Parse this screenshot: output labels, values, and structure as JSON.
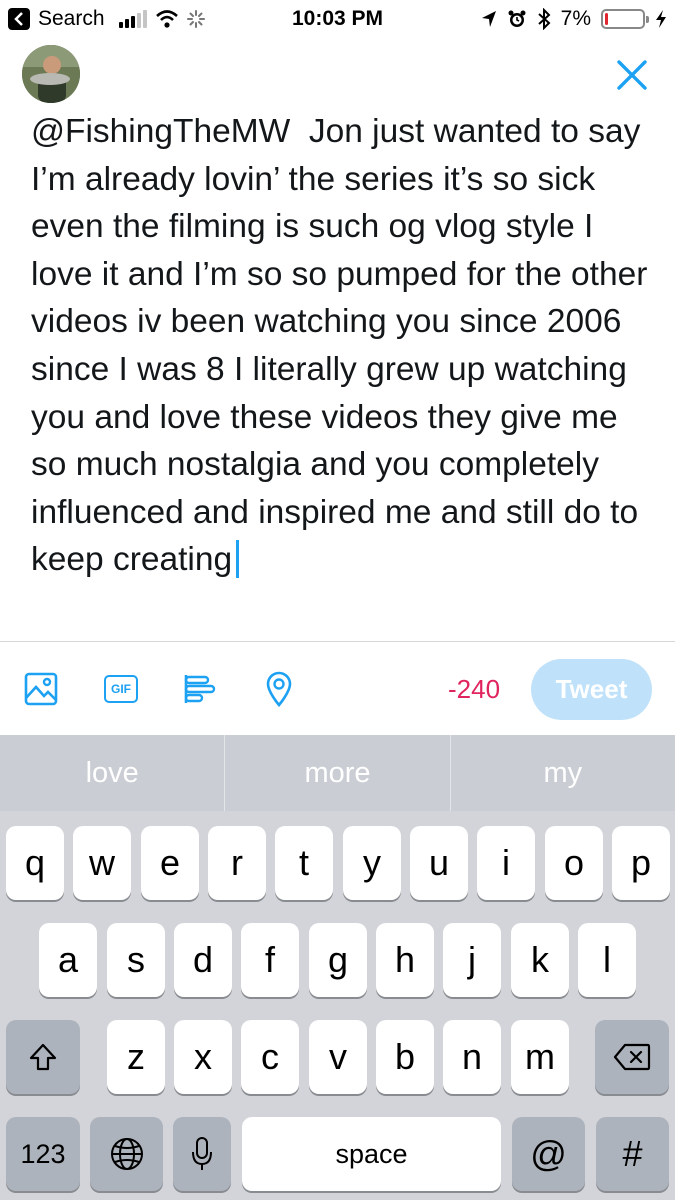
{
  "status_bar": {
    "back_label": "Search",
    "time": "10:03 PM",
    "battery_percent": "7%",
    "battery_level": 0.07,
    "icons": [
      "signal-icon",
      "wifi-icon",
      "activity-icon",
      "location-arrow-icon",
      "alarm-icon",
      "bluetooth-icon",
      "battery-icon",
      "charging-bolt-icon"
    ]
  },
  "compose": {
    "avatar": "profile-photo",
    "close_icon": "close-x-icon",
    "tweet_text": "@FishingTheMW  Jon just wanted to say I’m already lovin’ the series it’s so sick even the filming is such og vlog style I love it and I’m so so pumped for the other videos iv been watching you since 2006 since I was 8 I literally grew up watching you and love these videos they give me so much nostalgia and you completely influenced and inspired me and still do to keep creating",
    "toolbar_icons": [
      "image-icon",
      "gif-icon",
      "poll-icon",
      "location-pin-icon"
    ],
    "gif_label": "GIF",
    "char_count": "-240",
    "tweet_button": "Tweet",
    "accent_color": "#1da1f2",
    "warning_color": "#e0245e"
  },
  "keyboard": {
    "suggestions": [
      "love",
      "more",
      "my"
    ],
    "row1": [
      "q",
      "w",
      "e",
      "r",
      "t",
      "y",
      "u",
      "i",
      "o",
      "p"
    ],
    "row2": [
      "a",
      "s",
      "d",
      "f",
      "g",
      "h",
      "j",
      "k",
      "l"
    ],
    "row3": [
      "z",
      "x",
      "c",
      "v",
      "b",
      "n",
      "m"
    ],
    "numbers_key": "123",
    "space_key": "space",
    "at_key": "@",
    "hash_key": "#"
  }
}
